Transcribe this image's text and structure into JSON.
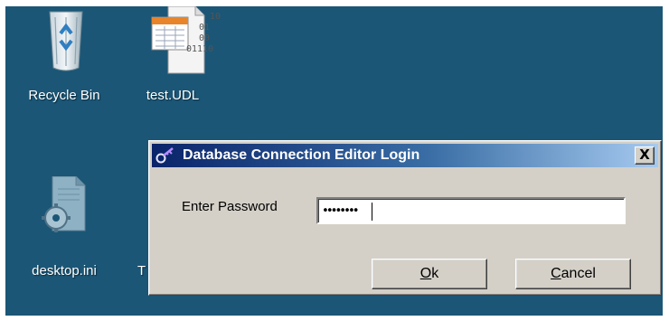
{
  "desktop": {
    "background": "#1b5676",
    "icons": [
      {
        "label": "Recycle Bin",
        "icon": "recycle-bin-icon"
      },
      {
        "label": "test.UDL",
        "icon": "udl-file-icon",
        "file_glyph_lines": [
          "10",
          "01",
          "00",
          "01110"
        ]
      },
      {
        "label": "desktop.ini",
        "icon": "settings-file-icon"
      }
    ],
    "partial_label": "T"
  },
  "dialog": {
    "title": "Database Connection Editor Login",
    "title_icon": "key-icon",
    "close_label": "X",
    "password_label": "Enter Password",
    "password_value": "••••••••",
    "ok_button": {
      "accel": "O",
      "rest": "k"
    },
    "cancel_button": {
      "accel": "C",
      "rest": "ancel"
    },
    "colors": {
      "face": "#d4d0c8",
      "title_start": "#0a246a",
      "title_end": "#a6caf0"
    }
  }
}
